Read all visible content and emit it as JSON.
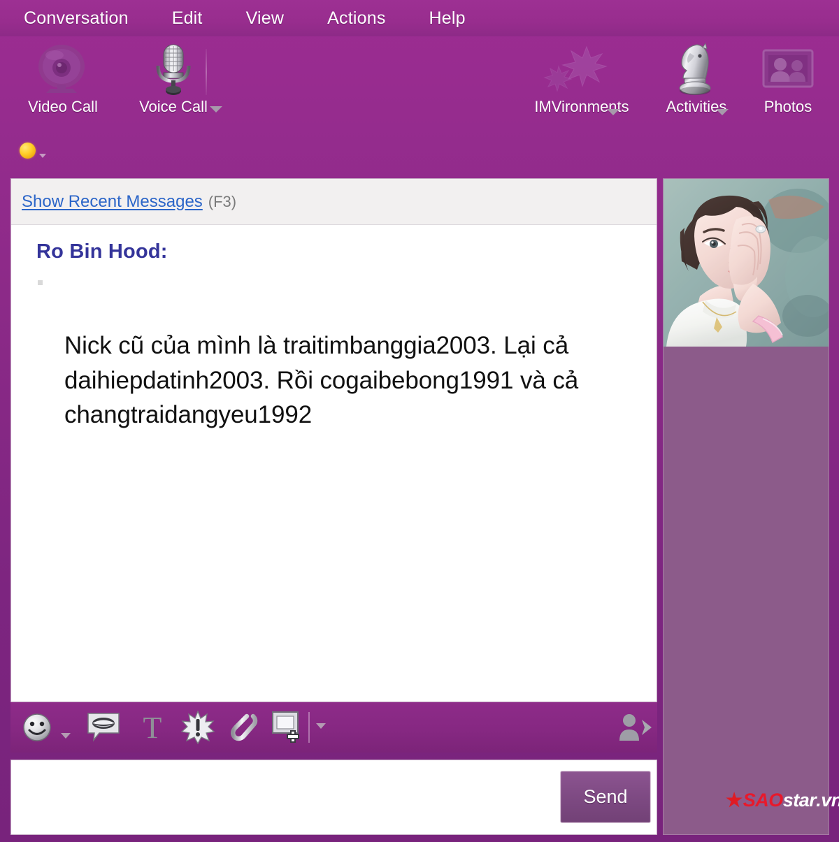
{
  "window": {
    "app": "Yahoo! Messenger Conversation",
    "chrome_color": "#8c2a88",
    "accent_color": "#9c2d92"
  },
  "menubar": {
    "items": [
      {
        "label": "Conversation",
        "name": "menu-conversation"
      },
      {
        "label": "Edit",
        "name": "menu-edit"
      },
      {
        "label": "View",
        "name": "menu-view"
      },
      {
        "label": "Actions",
        "name": "menu-actions"
      },
      {
        "label": "Help",
        "name": "menu-help"
      }
    ]
  },
  "toolbar": {
    "buttons": [
      {
        "label": "Video Call",
        "icon": "webcam-icon",
        "has_dropdown": false,
        "enabled": false
      },
      {
        "label": "Voice Call",
        "icon": "microphone-icon",
        "has_dropdown": true,
        "enabled": true
      },
      {
        "label": "IMVironments",
        "icon": "leaf-icon",
        "has_dropdown": true,
        "enabled": false
      },
      {
        "label": "Activities",
        "icon": "chess-knight-icon",
        "has_dropdown": true,
        "enabled": true
      },
      {
        "label": "Photos",
        "icon": "photo-frame-icon",
        "has_dropdown": false,
        "enabled": false
      }
    ]
  },
  "status": {
    "presence": "online",
    "presence_color": "#ffcf2a",
    "dropdown_icon": "chevron-down-icon"
  },
  "conversation": {
    "recent_link": "Show Recent Messages",
    "recent_shortcut": "(F3)",
    "messages": [
      {
        "sender": "Ro Bin Hood:",
        "sender_color": "#34349a",
        "text": "Nick cũ của mình là traitimbanggia2003. Lại cả daihiepdatinh2003. Rồi cogaibebong1991 và cả changtraidangyeu1992"
      }
    ]
  },
  "im_toolbar": {
    "buttons": [
      {
        "name": "emoticon-button",
        "icon": "smiley-icon",
        "has_dropdown": true
      },
      {
        "name": "audible-button",
        "icon": "speech-mouth-icon",
        "has_dropdown": false
      },
      {
        "name": "font-format-button",
        "icon": "text-t-icon",
        "has_dropdown": false
      },
      {
        "name": "buzz-button",
        "icon": "buzz-starburst-icon",
        "has_dropdown": false
      },
      {
        "name": "attach-file-button",
        "icon": "paperclip-icon",
        "has_dropdown": false
      },
      {
        "name": "send-image-button",
        "icon": "add-image-icon",
        "has_dropdown": true
      }
    ],
    "right_button": {
      "name": "invite-contact-button",
      "icon": "person-forward-icon"
    }
  },
  "composer": {
    "value": "",
    "placeholder": "",
    "send_label": "Send"
  },
  "side_panel": {
    "avatar_alt": "buddy-photo",
    "background_color": "#8c5b8a"
  },
  "watermark": {
    "star": "★",
    "sao": "SAO",
    "star_text": "star",
    "vn": ".vn"
  }
}
